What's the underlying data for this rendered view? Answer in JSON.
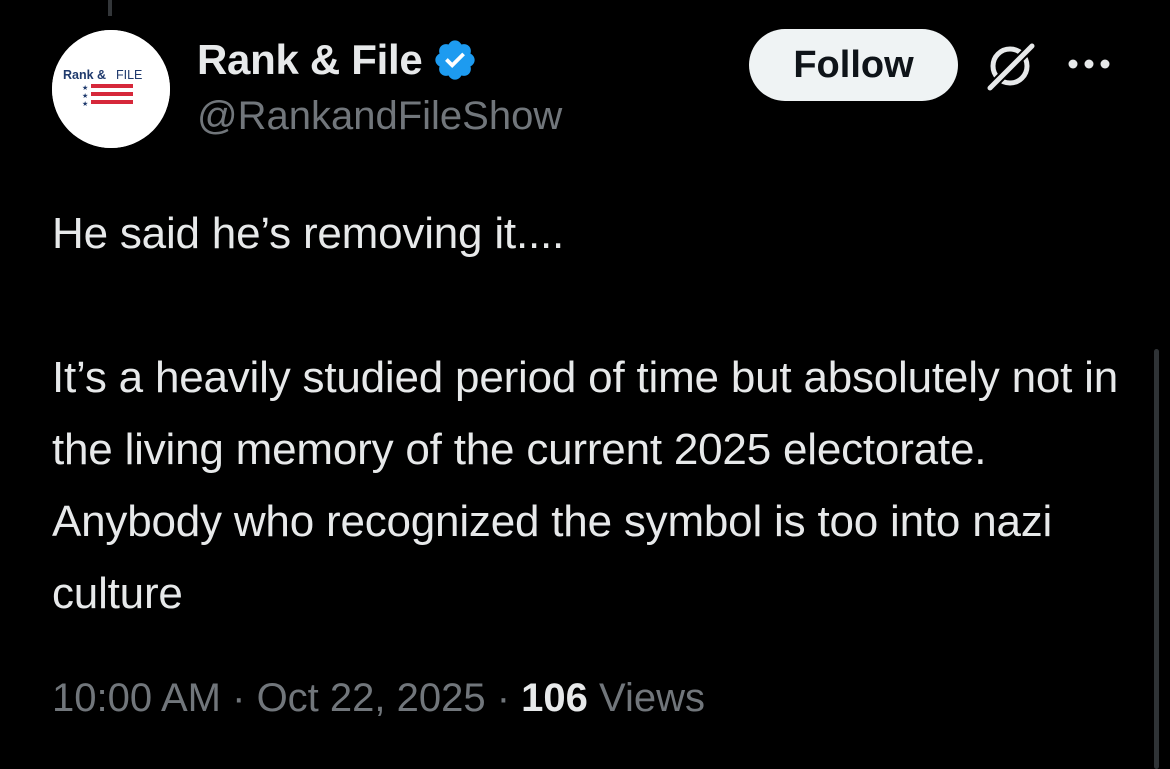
{
  "author": {
    "display_name": "Rank & File",
    "handle": "@RankandFileShow",
    "avatar_text": "Rank & FILE",
    "verified": true
  },
  "actions": {
    "follow_label": "Follow"
  },
  "icons": {
    "verified": "verified-badge-icon",
    "grok": "grok-icon",
    "more": "more-options-icon"
  },
  "tweet": {
    "text": "He said he’s removing it....\n\nIt’s a heavily studied period of time but absolutely not in the living memory of the current 2025 electorate. Anybody who recognized the symbol is too into nazi culture",
    "time": "10:00 AM",
    "separator": " · ",
    "date": "Oct 22, 2025",
    "views_count": "106",
    "views_label": " Views"
  },
  "colors": {
    "background": "#000000",
    "primary_text": "#e7e9ea",
    "secondary_text": "#71767b",
    "verified_blue": "#1d9bf0",
    "follow_bg": "#eff3f4"
  }
}
